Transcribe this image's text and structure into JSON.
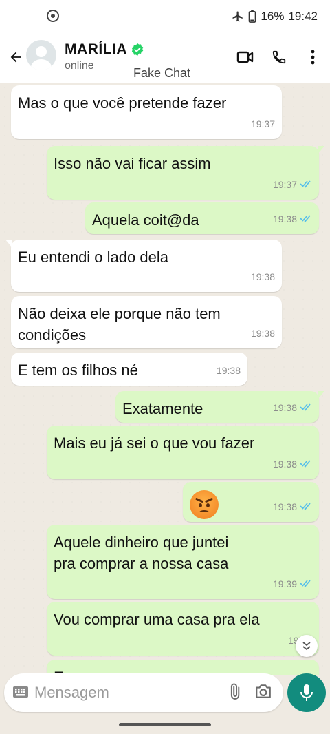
{
  "status_bar": {
    "battery": "16%",
    "time": "19:42"
  },
  "header": {
    "contact_name": "MARÍLIA",
    "contact_status": "online",
    "watermark": "Fake Chat",
    "icons": [
      "back-arrow-icon",
      "avatar",
      "verified-icon",
      "video-call-icon",
      "phone-icon",
      "more-icon"
    ]
  },
  "messages": [
    {
      "direction": "in",
      "text": "Mas o que você pretende fazer",
      "time": "19:37"
    },
    {
      "direction": "out",
      "text": "Isso não vai ficar assim",
      "time": "19:37",
      "read": true
    },
    {
      "direction": "out",
      "text": "Aquela coit@da",
      "time": "19:38",
      "read": true
    },
    {
      "direction": "in",
      "text": "Eu entendi o lado dela",
      "time": "19:38"
    },
    {
      "direction": "in",
      "text": "Não deixa ele porque não tem\ncondições",
      "time": "19:38"
    },
    {
      "direction": "in",
      "text": "E tem os filhos né",
      "time": "19:38"
    },
    {
      "direction": "out",
      "text": "Exatamente",
      "time": "19:38",
      "read": true
    },
    {
      "direction": "out",
      "text": "Mais eu já sei o que vou fazer",
      "time": "19:38",
      "read": true
    },
    {
      "direction": "out",
      "emoji": "angry-face",
      "time": "19:38",
      "read": true
    },
    {
      "direction": "out",
      "text": "Aquele dinheiro que juntei\npra comprar a nossa casa",
      "time": "19:39",
      "read": true
    },
    {
      "direction": "out",
      "text": "Vou comprar uma casa pra ela",
      "time": "19:39",
      "read": true
    },
    {
      "direction": "out",
      "text": "E",
      "time": ""
    }
  ],
  "input": {
    "placeholder": "Mensagem",
    "value": ""
  },
  "colors": {
    "incoming_bubble": "#ffffff",
    "outgoing_bubble": "#dcf8c6",
    "read_ticks": "#53bdeb",
    "mic_button": "#128c7e",
    "verified": "#25d366"
  }
}
